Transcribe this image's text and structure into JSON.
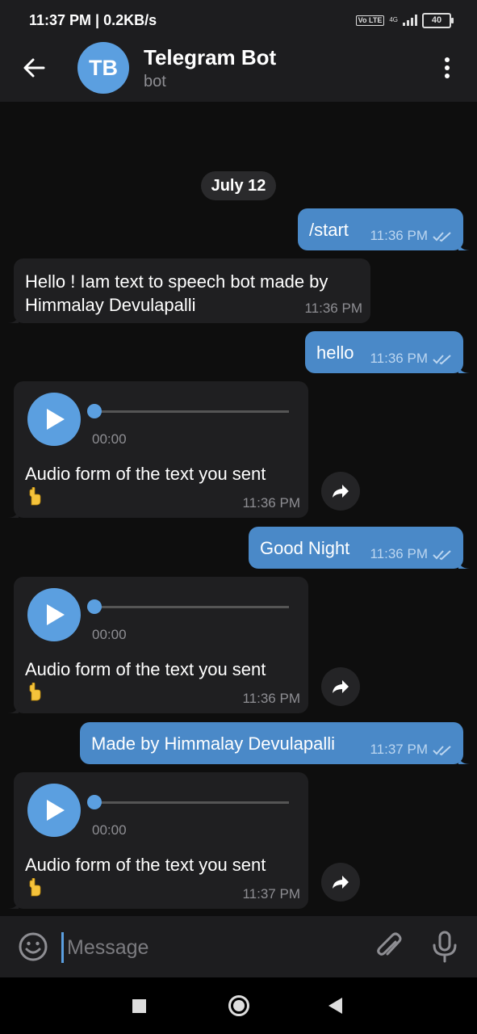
{
  "status_bar": {
    "time_speed": "11:37 PM | 0.2KB/s",
    "volte": "Vo LTE",
    "network": "4G",
    "battery": "40"
  },
  "header": {
    "avatar_initials": "TB",
    "title": "Telegram Bot",
    "subtitle": "bot"
  },
  "chat": {
    "date": "July 12",
    "messages": [
      {
        "direction": "outgoing",
        "text": "/start",
        "time": "11:36 PM",
        "read": true
      },
      {
        "direction": "incoming",
        "text": "Hello ! Iam text to speech bot made by Himmalay Devulapalli",
        "time": "11:36 PM"
      },
      {
        "direction": "outgoing",
        "text": "hello",
        "time": "11:36 PM",
        "read": true
      },
      {
        "direction": "incoming",
        "type": "audio",
        "duration": "00:00",
        "caption": "Audio form of the text you sent",
        "time": "11:36 PM"
      },
      {
        "direction": "outgoing",
        "text": "Good Night",
        "time": "11:36 PM",
        "read": true
      },
      {
        "direction": "incoming",
        "type": "audio",
        "duration": "00:00",
        "caption": "Audio form of the text you sent",
        "time": "11:36 PM"
      },
      {
        "direction": "outgoing",
        "text": "Made by Himmalay Devulapalli",
        "time": "11:37 PM",
        "read": true
      },
      {
        "direction": "incoming",
        "type": "audio",
        "duration": "00:00",
        "caption": "Audio form of the text you sent",
        "time": "11:37 PM"
      }
    ]
  },
  "input": {
    "placeholder": "Message"
  },
  "colors": {
    "accent": "#5b9fe0",
    "outgoing_bubble": "#4a89c8",
    "incoming_bubble": "#1f1f21",
    "background": "#0e0e0e",
    "bar": "#1d1d1f"
  },
  "icons": [
    "back-arrow-icon",
    "more-vertical-icon",
    "play-icon",
    "forward-icon",
    "double-check-icon",
    "pointing-up-emoji-icon",
    "emoji-icon",
    "paperclip-icon",
    "microphone-icon",
    "nav-recents-icon",
    "nav-home-icon",
    "nav-back-icon"
  ]
}
